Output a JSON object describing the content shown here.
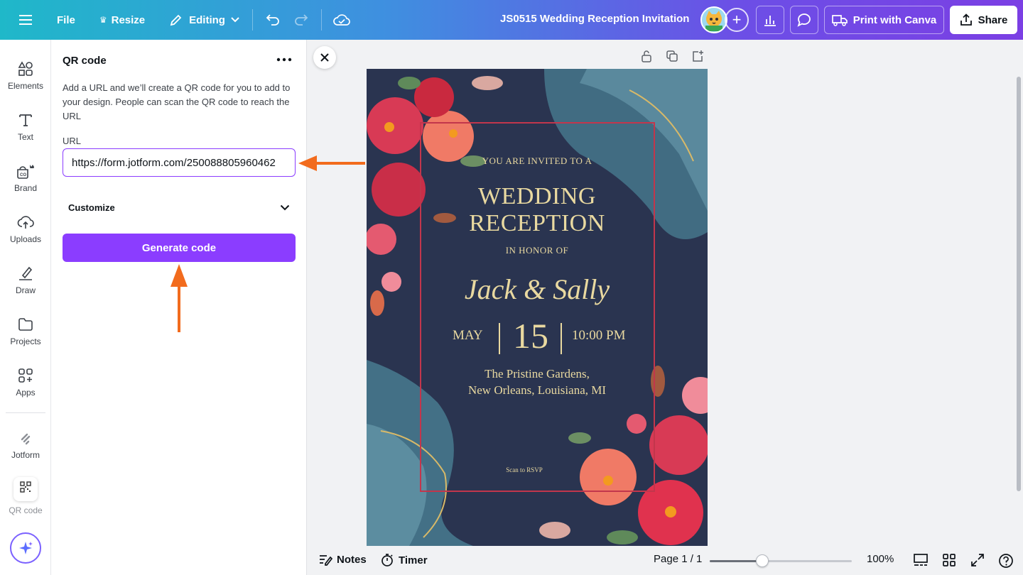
{
  "topbar": {
    "menu_items": [
      "File",
      "Resize",
      "Editing"
    ],
    "doc_title": "JS0515 Wedding Reception Invitation",
    "print_label": "Print with Canva",
    "share_label": "Share"
  },
  "rail": {
    "items": [
      "Elements",
      "Text",
      "Brand",
      "Uploads",
      "Draw",
      "Projects",
      "Apps",
      "Jotform",
      "QR code"
    ]
  },
  "panel": {
    "title": "QR code",
    "description": "Add a URL and we’ll create a QR code for you to add to your design. People can scan the QR code to reach the URL",
    "url_label": "URL",
    "url_value": "https://form.jotform.com/250088805960462",
    "customize_label": "Customize",
    "generate_label": "Generate code"
  },
  "invitation": {
    "line1": "YOU ARE INVITED TO A",
    "line2": "WEDDING",
    "line3": "RECEPTION",
    "line4": "IN HONOR OF",
    "names": "Jack & Sally",
    "month": "MAY",
    "day": "15",
    "time": "10:00 PM",
    "venue1": "The Pristine Gardens,",
    "venue2": "New Orleans, Louisiana, MI",
    "scan": "Scan to RSVP"
  },
  "bottombar": {
    "notes_label": "Notes",
    "timer_label": "Timer",
    "page_label": "Page 1 / 1",
    "zoom_value": 100,
    "zoom_label": "100%"
  },
  "colors": {
    "accent": "#8b3dff",
    "arrow": "#f26b1d",
    "invite_bg": "#2a3450",
    "invite_gold": "#e9d9a0",
    "frame_red": "#c2364c"
  }
}
